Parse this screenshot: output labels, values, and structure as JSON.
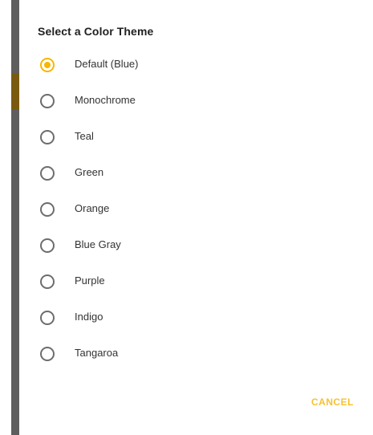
{
  "dialog": {
    "title": "Select a Color Theme",
    "options": [
      {
        "label": "Default (Blue)",
        "selected": true
      },
      {
        "label": "Monochrome",
        "selected": false
      },
      {
        "label": "Teal",
        "selected": false
      },
      {
        "label": "Green",
        "selected": false
      },
      {
        "label": "Orange",
        "selected": false
      },
      {
        "label": "Blue Gray",
        "selected": false
      },
      {
        "label": "Purple",
        "selected": false
      },
      {
        "label": "Indigo",
        "selected": false
      },
      {
        "label": "Tangaroa",
        "selected": false
      }
    ],
    "cancel_label": "CANCEL"
  },
  "colors": {
    "accent": "#f6b700",
    "cancel_text": "#f6c232",
    "radio_unchecked": "#6d6d6d",
    "side_edge": "#5e5e5e",
    "side_accent": "#7a5a10"
  },
  "icons": {
    "radio_checked": "radio-checked-icon",
    "radio_unchecked": "radio-unchecked-icon"
  }
}
